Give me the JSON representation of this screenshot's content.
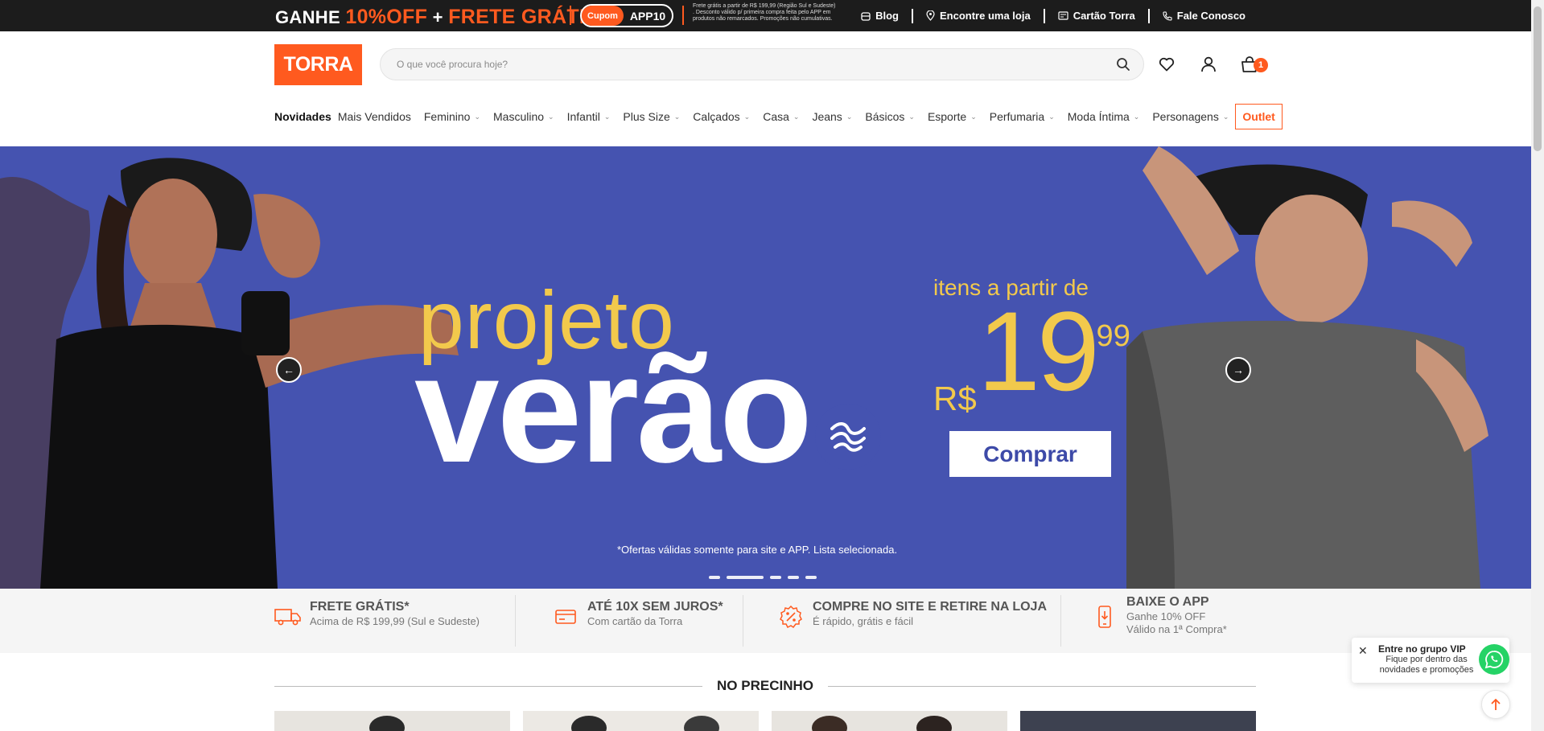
{
  "promo": {
    "ganhe": "GANHE",
    "off": "10%OFF",
    "plus": "+",
    "frete": "FRETE GRÁTIS",
    "coupon_label": "Cupom",
    "coupon_code": "APP10",
    "note": "Frete grátis a partir de R$ 199,99 (Região Sul e Sudeste) . Desconto válido p/ primeira compra feita pelo APP em produtos não remarcados. Promoções não cumulativas."
  },
  "toplinks": [
    {
      "label": "Blog",
      "icon": "blog-icon"
    },
    {
      "label": "Encontre uma loja",
      "icon": "location-pin-icon"
    },
    {
      "label": "Cartão Torra",
      "icon": "card-icon"
    },
    {
      "label": "Fale Conosco",
      "icon": "phone-icon"
    }
  ],
  "header": {
    "logo": "TORRA",
    "search_placeholder": "O que você procura hoje?",
    "cart_count": "1"
  },
  "nav": {
    "items": [
      "Novidades",
      "Mais Vendidos",
      "Feminino",
      "Masculino",
      "Infantil",
      "Plus Size",
      "Calçados",
      "Casa",
      "Jeans",
      "Básicos",
      "Esporte",
      "Perfumaria",
      "Moda Íntima",
      "Personagens"
    ],
    "outlet": "Outlet"
  },
  "hero": {
    "line1": "projeto",
    "line2": "verão",
    "subtitle": "itens a partir de",
    "currency": "R$",
    "price": "19",
    "cents": ",99",
    "button": "Comprar",
    "note": "*Ofertas válidas somente para site e APP. Lista selecionada.",
    "slides": 5,
    "active_slide": 2,
    "bg_color": "#4553b0",
    "accent_color": "#f2c94c"
  },
  "benefits": [
    {
      "title": "FRETE GRÁTIS*",
      "sub": "Acima de R$ 199,99 (Sul e Sudeste)",
      "icon": "truck-icon"
    },
    {
      "title": "ATÉ 10X SEM JUROS*",
      "sub": "Com cartão da Torra",
      "icon": "credit-card-icon"
    },
    {
      "title": "COMPRE NO SITE E RETIRE NA LOJA",
      "sub": "É rápido, grátis e fácil",
      "icon": "percent-badge-icon"
    },
    {
      "title": "BAIXE O APP",
      "sub": "Ganhe 10% OFF",
      "sub2": "Válido na 1ª Compra*",
      "icon": "smartphone-icon"
    }
  ],
  "section": {
    "title": "NO PRECINHO"
  },
  "vip": {
    "title": "Entre no grupo VIP",
    "text": "Fique por dentro das novidades e promoções"
  },
  "colors": {
    "brand": "#ff5a1f",
    "topbar": "#1c1c1c"
  }
}
